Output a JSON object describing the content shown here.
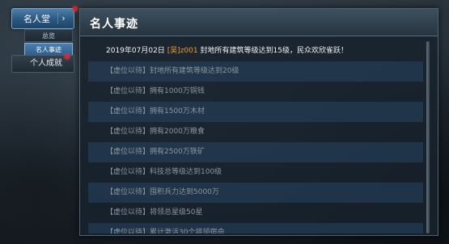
{
  "sidebar": {
    "main_label": "名人堂",
    "sub_items": [
      {
        "label": "总览"
      },
      {
        "label": "名人事迹"
      }
    ],
    "second_label": "个人成就"
  },
  "panel": {
    "title": "名人事迹"
  },
  "feed": {
    "first": {
      "date": "2019年07月02日",
      "player": "[吴]z001",
      "text": "封地所有建筑等级达到15级，民众欢欣雀跃！"
    },
    "rows": [
      {
        "text": "【虚位以待】封地所有建筑等级达到20级"
      },
      {
        "text": "【虚位以待】拥有1000万铜钱"
      },
      {
        "text": "【虚位以待】拥有1500万木材"
      },
      {
        "text": "【虚位以待】拥有2000万粮食"
      },
      {
        "text": "【虚位以待】拥有2500万铁矿"
      },
      {
        "text": "【虚位以待】科技总等级达到100级"
      },
      {
        "text": "【虚位以待】囤积兵力达到5000万"
      },
      {
        "text": "【虚位以待】将领总星级50星"
      },
      {
        "text": "【虚位以待】累计激活30个将领宿命"
      }
    ]
  },
  "colors": {
    "accent": "#2f5f8c",
    "player_name": "#ee9a2a",
    "notification": "#e0242a"
  }
}
